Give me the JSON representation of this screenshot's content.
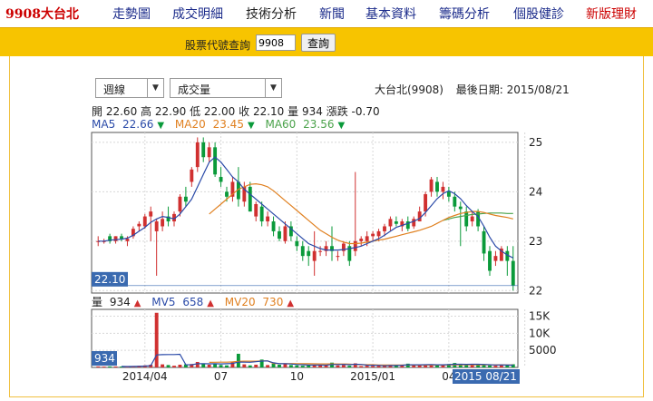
{
  "nav": {
    "brand": "9908大台北",
    "items": [
      {
        "label": "走勢圖",
        "active": false
      },
      {
        "label": "成交明細",
        "active": false
      },
      {
        "label": "技術分析",
        "active": true
      },
      {
        "label": "新聞",
        "active": false
      },
      {
        "label": "基本資料",
        "active": false
      },
      {
        "label": "籌碼分析",
        "active": false
      },
      {
        "label": "個股健診",
        "active": false
      },
      {
        "label": "新版理財",
        "active": false
      }
    ]
  },
  "search": {
    "label": "股票代號查詢",
    "value": "9908",
    "button": "查詢"
  },
  "controls": {
    "period": "週線",
    "indicator": "成交量",
    "stock_info": "大台北(9908)",
    "last_date_label": "最後日期:",
    "last_date": "2015/08/21"
  },
  "ohlc": {
    "open_label": "開",
    "open": "22.60",
    "high_label": "高",
    "high": "22.90",
    "low_label": "低",
    "low": "22.00",
    "close_label": "收",
    "close": "22.10",
    "vol_label": "量",
    "vol": "934",
    "chg_label": "漲跌",
    "chg": "-0.70"
  },
  "ma": {
    "ma5_label": "MA5",
    "ma5": "22.66",
    "ma20_label": "MA20",
    "ma20": "23.45",
    "ma60_label": "MA60",
    "ma60": "23.56"
  },
  "vol_legend": {
    "vol_label": "量",
    "vol": "934",
    "mv5_label": "MV5",
    "mv5": "658",
    "mv20_label": "MV20",
    "mv20": "730"
  },
  "colors": {
    "up": "#d03030",
    "down": "#0a9a3a",
    "ma5": "#2a4aa8",
    "ma20": "#e08020",
    "ma60": "#4aa24a",
    "accent_bar": "#f7c400",
    "label_box": "#3a6ab0"
  },
  "chart_data": [
    {
      "type": "candlestick",
      "ylim": [
        21.95,
        25.2
      ],
      "yticks": [
        "25",
        "24",
        "23",
        "22"
      ],
      "ytick_values": [
        25,
        24,
        23,
        22
      ],
      "current_price_label": "22.10",
      "xticks": [
        "2014/04",
        "07",
        "10",
        "2015/01",
        "04",
        "2015 08/21"
      ],
      "xtick_index": [
        8,
        21,
        34,
        47,
        60,
        73
      ],
      "candles": [
        [
          23.0,
          23.1,
          22.9,
          23.0
        ],
        [
          23.0,
          23.05,
          22.95,
          23.0
        ],
        [
          23.1,
          23.15,
          22.95,
          23.0
        ],
        [
          23.0,
          23.1,
          22.95,
          23.1
        ],
        [
          23.1,
          23.15,
          23.0,
          23.05
        ],
        [
          23.0,
          23.1,
          22.9,
          23.05
        ],
        [
          23.1,
          23.3,
          23.05,
          23.25
        ],
        [
          23.3,
          23.4,
          23.2,
          23.35
        ],
        [
          23.3,
          23.55,
          23.25,
          23.5
        ],
        [
          23.5,
          23.7,
          23.0,
          23.6
        ],
        [
          23.2,
          23.45,
          22.3,
          23.4
        ],
        [
          23.3,
          23.6,
          23.2,
          23.45
        ],
        [
          23.5,
          23.7,
          23.3,
          23.4
        ],
        [
          23.4,
          23.6,
          23.3,
          23.55
        ],
        [
          23.6,
          23.95,
          23.5,
          23.9
        ],
        [
          23.9,
          24.1,
          23.7,
          23.8
        ],
        [
          24.2,
          24.5,
          24.1,
          24.45
        ],
        [
          24.5,
          25.1,
          24.4,
          25.0
        ],
        [
          25.0,
          25.1,
          24.6,
          24.7
        ],
        [
          24.7,
          25.0,
          24.6,
          24.9
        ],
        [
          24.9,
          25.0,
          24.3,
          24.35
        ],
        [
          24.3,
          24.5,
          24.1,
          24.2
        ],
        [
          24.0,
          24.1,
          23.8,
          23.9
        ],
        [
          23.9,
          24.3,
          23.8,
          24.2
        ],
        [
          24.2,
          24.5,
          23.7,
          23.85
        ],
        [
          23.8,
          24.2,
          23.7,
          24.1
        ],
        [
          24.1,
          24.2,
          23.6,
          23.6
        ],
        [
          23.5,
          23.8,
          23.4,
          23.75
        ],
        [
          23.7,
          23.8,
          23.3,
          23.4
        ],
        [
          23.4,
          23.6,
          23.3,
          23.5
        ],
        [
          23.4,
          23.5,
          23.1,
          23.2
        ],
        [
          23.2,
          23.3,
          23.0,
          23.05
        ],
        [
          23.0,
          23.4,
          22.95,
          23.3
        ],
        [
          23.3,
          23.4,
          23.0,
          23.1
        ],
        [
          23.0,
          23.1,
          22.8,
          22.9
        ],
        [
          22.9,
          23.0,
          22.6,
          22.7
        ],
        [
          22.8,
          22.9,
          22.5,
          22.7
        ],
        [
          22.6,
          23.2,
          22.3,
          22.8
        ],
        [
          22.8,
          22.9,
          22.7,
          22.8
        ],
        [
          22.8,
          23.0,
          22.7,
          22.9
        ],
        [
          22.9,
          23.3,
          22.6,
          22.8
        ],
        [
          22.7,
          22.8,
          22.6,
          22.7
        ],
        [
          22.8,
          23.0,
          22.7,
          22.95
        ],
        [
          22.9,
          23.0,
          22.5,
          22.6
        ],
        [
          22.8,
          24.4,
          22.7,
          23.0
        ],
        [
          23.0,
          23.1,
          22.9,
          23.05
        ],
        [
          23.0,
          23.2,
          22.9,
          23.1
        ],
        [
          23.1,
          23.2,
          23.0,
          23.15
        ],
        [
          23.1,
          23.25,
          23.0,
          23.2
        ],
        [
          23.2,
          23.35,
          23.1,
          23.3
        ],
        [
          23.3,
          23.5,
          23.2,
          23.45
        ],
        [
          23.4,
          23.5,
          23.3,
          23.35
        ],
        [
          23.3,
          23.45,
          23.2,
          23.4
        ],
        [
          23.4,
          23.5,
          23.2,
          23.25
        ],
        [
          23.3,
          23.5,
          23.25,
          23.45
        ],
        [
          23.4,
          23.7,
          23.4,
          23.6
        ],
        [
          23.6,
          24.0,
          23.5,
          23.95
        ],
        [
          24.0,
          24.3,
          23.9,
          24.25
        ],
        [
          24.2,
          24.3,
          23.9,
          24.0
        ],
        [
          24.0,
          24.2,
          23.85,
          24.1
        ],
        [
          24.0,
          24.1,
          23.8,
          23.9
        ],
        [
          23.9,
          24.0,
          23.6,
          23.7
        ],
        [
          23.7,
          23.8,
          22.9,
          23.65
        ],
        [
          23.6,
          23.7,
          23.2,
          23.3
        ],
        [
          23.4,
          23.6,
          23.3,
          23.5
        ],
        [
          23.6,
          23.65,
          23.2,
          23.3
        ],
        [
          23.2,
          23.3,
          22.6,
          22.75
        ],
        [
          22.8,
          22.9,
          22.3,
          22.4
        ],
        [
          22.6,
          22.8,
          22.5,
          22.7
        ],
        [
          22.6,
          22.9,
          22.6,
          22.85
        ],
        [
          22.8,
          22.9,
          22.3,
          22.6
        ],
        [
          22.6,
          22.9,
          22.0,
          22.1
        ]
      ],
      "ma5": [
        23.0,
        23.0,
        23.02,
        23.03,
        23.04,
        23.06,
        23.12,
        23.2,
        23.28,
        23.38,
        23.45,
        23.5,
        23.48,
        23.45,
        23.55,
        23.7,
        23.85,
        24.1,
        24.35,
        24.6,
        24.7,
        24.6,
        24.45,
        24.3,
        24.2,
        24.05,
        23.95,
        23.85,
        23.75,
        23.65,
        23.55,
        23.45,
        23.35,
        23.25,
        23.15,
        23.05,
        22.95,
        22.9,
        22.85,
        22.82,
        22.82,
        22.82,
        22.83,
        22.85,
        22.87,
        22.9,
        22.95,
        23.0,
        23.05,
        23.12,
        23.2,
        23.28,
        23.32,
        23.36,
        23.4,
        23.46,
        23.58,
        23.72,
        23.86,
        23.96,
        24.02,
        23.96,
        23.86,
        23.72,
        23.6,
        23.5,
        23.3,
        23.08,
        22.9,
        22.8,
        22.72,
        22.66
      ],
      "ma20": [
        null,
        null,
        null,
        null,
        null,
        null,
        null,
        null,
        null,
        null,
        null,
        null,
        null,
        null,
        null,
        null,
        null,
        null,
        null,
        23.55,
        23.65,
        23.75,
        23.85,
        23.95,
        24.05,
        24.1,
        24.15,
        24.16,
        24.14,
        24.1,
        24.02,
        23.92,
        23.82,
        23.72,
        23.62,
        23.52,
        23.42,
        23.32,
        23.22,
        23.15,
        23.08,
        23.02,
        22.98,
        22.95,
        22.95,
        22.96,
        22.98,
        23.0,
        23.02,
        23.04,
        23.07,
        23.1,
        23.13,
        23.16,
        23.19,
        23.22,
        23.26,
        23.3,
        23.36,
        23.42,
        23.48,
        23.52,
        23.56,
        23.58,
        23.6,
        23.6,
        23.58,
        23.55,
        23.52,
        23.5,
        23.48,
        23.45
      ],
      "ma60": [
        null,
        null,
        null,
        null,
        null,
        null,
        null,
        null,
        null,
        null,
        null,
        null,
        null,
        null,
        null,
        null,
        null,
        null,
        null,
        null,
        null,
        null,
        null,
        null,
        null,
        null,
        null,
        null,
        null,
        null,
        null,
        null,
        null,
        null,
        null,
        null,
        null,
        null,
        null,
        null,
        null,
        null,
        null,
        null,
        null,
        null,
        null,
        null,
        null,
        null,
        null,
        null,
        null,
        null,
        null,
        null,
        null,
        null,
        null,
        23.42,
        23.45,
        23.48,
        23.5,
        23.52,
        23.54,
        23.55,
        23.56,
        23.57,
        23.57,
        23.57,
        23.56,
        23.56
      ]
    },
    {
      "type": "bar",
      "title": "成交量",
      "ylim": [
        0,
        17000
      ],
      "yticks": [
        "15K",
        "10K",
        "5000"
      ],
      "ytick_values": [
        15000,
        10000,
        5000
      ],
      "current_value_label": "934",
      "values": [
        300,
        250,
        300,
        280,
        260,
        250,
        400,
        500,
        600,
        800,
        16000,
        900,
        700,
        500,
        800,
        900,
        1000,
        1600,
        1200,
        800,
        1100,
        700,
        600,
        1500,
        4000,
        900,
        600,
        800,
        2300,
        700,
        1100,
        800,
        1200,
        700,
        600,
        500,
        700,
        800,
        600,
        700,
        1400,
        600,
        700,
        500,
        1200,
        400,
        500,
        450,
        500,
        600,
        700,
        600,
        800,
        1100,
        600,
        700,
        800,
        900,
        700,
        800,
        1000,
        1300,
        900,
        700,
        800,
        1000,
        900,
        600,
        500,
        700,
        650,
        934
      ],
      "mv5": [
        null,
        null,
        null,
        null,
        300,
        270,
        300,
        350,
        410,
        500,
        3660,
        3740,
        3760,
        3780,
        3840,
        800,
        760,
        1100,
        1100,
        1060,
        1100,
        1040,
        1100,
        1160,
        1580,
        1540,
        1520,
        1680,
        1860,
        1900,
        1360,
        1100,
        1100,
        1000,
        860,
        800,
        700,
        700,
        700,
        660,
        840,
        840,
        880,
        800,
        920,
        880,
        660,
        640,
        610,
        490,
        550,
        570,
        630,
        760,
        760,
        760,
        800,
        860,
        760,
        780,
        820,
        940,
        940,
        900,
        940,
        940,
        880,
        800,
        720,
        740,
        690,
        658
      ],
      "mv20": [
        null,
        null,
        null,
        null,
        null,
        null,
        null,
        null,
        null,
        null,
        null,
        null,
        null,
        null,
        null,
        null,
        null,
        null,
        null,
        1480,
        1520,
        1540,
        1550,
        1610,
        1790,
        1820,
        1830,
        1840,
        1920,
        1920,
        1130,
        1120,
        1120,
        1130,
        1120,
        1120,
        1100,
        1060,
        1030,
        1030,
        1040,
        1020,
        1020,
        990,
        850,
        820,
        810,
        800,
        710,
        710,
        700,
        700,
        690,
        700,
        700,
        690,
        700,
        700,
        700,
        720,
        720,
        740,
        750,
        750,
        760,
        780,
        790,
        780,
        760,
        760,
        750,
        730
      ]
    }
  ]
}
